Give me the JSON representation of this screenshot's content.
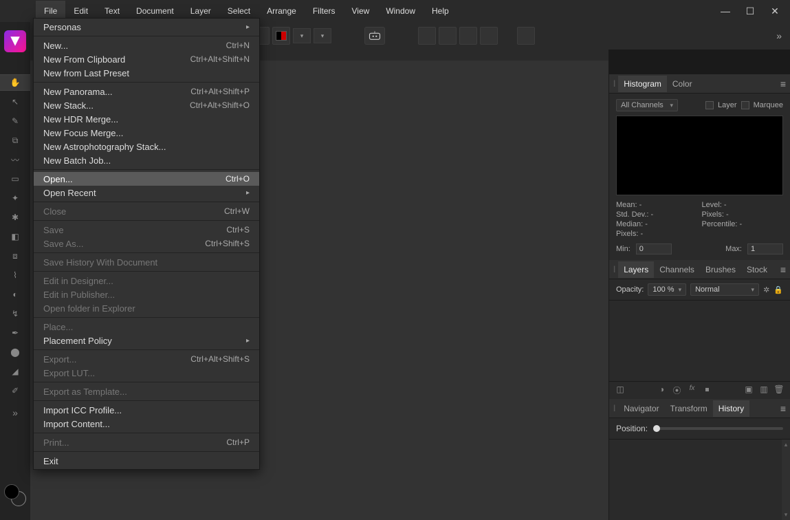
{
  "menubar": [
    "File",
    "Edit",
    "Text",
    "Document",
    "Layer",
    "Select",
    "Arrange",
    "Filters",
    "View",
    "Window",
    "Help"
  ],
  "activeMenu": 0,
  "fileMenu": [
    {
      "type": "sub",
      "label": "Personas"
    },
    {
      "type": "sep"
    },
    {
      "type": "item",
      "label": "New...",
      "shortcut": "Ctrl+N"
    },
    {
      "type": "item",
      "label": "New From Clipboard",
      "shortcut": "Ctrl+Alt+Shift+N"
    },
    {
      "type": "item",
      "label": "New from Last Preset"
    },
    {
      "type": "sep"
    },
    {
      "type": "item",
      "label": "New Panorama...",
      "shortcut": "Ctrl+Alt+Shift+P"
    },
    {
      "type": "item",
      "label": "New Stack...",
      "shortcut": "Ctrl+Alt+Shift+O"
    },
    {
      "type": "item",
      "label": "New HDR Merge..."
    },
    {
      "type": "item",
      "label": "New Focus Merge..."
    },
    {
      "type": "item",
      "label": "New Astrophotography Stack..."
    },
    {
      "type": "item",
      "label": "New Batch Job..."
    },
    {
      "type": "sep"
    },
    {
      "type": "item",
      "label": "Open...",
      "shortcut": "Ctrl+O",
      "hover": true
    },
    {
      "type": "sub",
      "label": "Open Recent"
    },
    {
      "type": "sep"
    },
    {
      "type": "item",
      "label": "Close",
      "shortcut": "Ctrl+W",
      "disabled": true
    },
    {
      "type": "sep"
    },
    {
      "type": "item",
      "label": "Save",
      "shortcut": "Ctrl+S",
      "disabled": true
    },
    {
      "type": "item",
      "label": "Save As...",
      "shortcut": "Ctrl+Shift+S",
      "disabled": true
    },
    {
      "type": "sep"
    },
    {
      "type": "item",
      "label": "Save History With Document",
      "disabled": true
    },
    {
      "type": "sep"
    },
    {
      "type": "item",
      "label": "Edit in Designer...",
      "disabled": true
    },
    {
      "type": "item",
      "label": "Edit in Publisher...",
      "disabled": true
    },
    {
      "type": "item",
      "label": "Open folder in Explorer",
      "disabled": true
    },
    {
      "type": "sep"
    },
    {
      "type": "item",
      "label": "Place...",
      "disabled": true
    },
    {
      "type": "sub",
      "label": "Placement Policy"
    },
    {
      "type": "sep"
    },
    {
      "type": "item",
      "label": "Export...",
      "shortcut": "Ctrl+Alt+Shift+S",
      "disabled": true
    },
    {
      "type": "item",
      "label": "Export LUT...",
      "disabled": true
    },
    {
      "type": "sep"
    },
    {
      "type": "item",
      "label": "Export as Template...",
      "disabled": true
    },
    {
      "type": "sep"
    },
    {
      "type": "item",
      "label": "Import ICC Profile..."
    },
    {
      "type": "item",
      "label": "Import Content..."
    },
    {
      "type": "sep"
    },
    {
      "type": "item",
      "label": "Print...",
      "shortcut": "Ctrl+P",
      "disabled": true
    },
    {
      "type": "sep"
    },
    {
      "type": "item",
      "label": "Exit"
    }
  ],
  "leftTools": [
    {
      "name": "hand-tool",
      "selected": true,
      "glyph": "✋"
    },
    {
      "name": "move-tool",
      "glyph": "↖"
    },
    {
      "name": "color-picker-tool",
      "glyph": "✎"
    },
    {
      "name": "crop-tool",
      "glyph": "⧉"
    },
    {
      "name": "selection-brush-tool",
      "glyph": "〰"
    },
    {
      "name": "marquee-tool",
      "glyph": "▭"
    },
    {
      "name": "flood-select-tool",
      "glyph": "✦"
    },
    {
      "name": "paint-brush-tool",
      "glyph": "✱"
    },
    {
      "name": "erase-tool",
      "glyph": "◧"
    },
    {
      "name": "clone-tool",
      "glyph": "⧈"
    },
    {
      "name": "inpainting-tool",
      "glyph": "⌇"
    },
    {
      "name": "dodge-tool",
      "glyph": "◐"
    },
    {
      "name": "smudge-tool",
      "glyph": "↯"
    },
    {
      "name": "pen-tool",
      "glyph": "✒"
    },
    {
      "name": "blur-tool",
      "glyph": "⬤"
    },
    {
      "name": "gradient-tool",
      "glyph": "◢"
    },
    {
      "name": "eyedropper-tool",
      "glyph": "✐"
    }
  ],
  "histogram": {
    "tabs": [
      "Histogram",
      "Color"
    ],
    "activeTab": 0,
    "channelSelect": "All Channels",
    "layerLabel": "Layer",
    "marqueeLabel": "Marquee",
    "stats": {
      "meanLabel": "Mean:",
      "mean": "-",
      "stdLabel": "Std. Dev.:",
      "std": "-",
      "medianLabel": "Median:",
      "median": "-",
      "pixelsLabel": "Pixels:",
      "pixels": "-",
      "levelLabel": "Level:",
      "level": "-",
      "pixels2Label": "Pixels:",
      "pixels2": "-",
      "pctLabel": "Percentile:",
      "pct": "-"
    },
    "minLabel": "Min:",
    "min": "0",
    "maxLabel": "Max:",
    "max": "1"
  },
  "layers": {
    "tabs": [
      "Layers",
      "Channels",
      "Brushes",
      "Stock"
    ],
    "activeTab": 0,
    "opacityLabel": "Opacity:",
    "opacity": "100 %",
    "blend": "Normal"
  },
  "history": {
    "tabs": [
      "Navigator",
      "Transform",
      "History"
    ],
    "activeTab": 2,
    "positionLabel": "Position:"
  }
}
